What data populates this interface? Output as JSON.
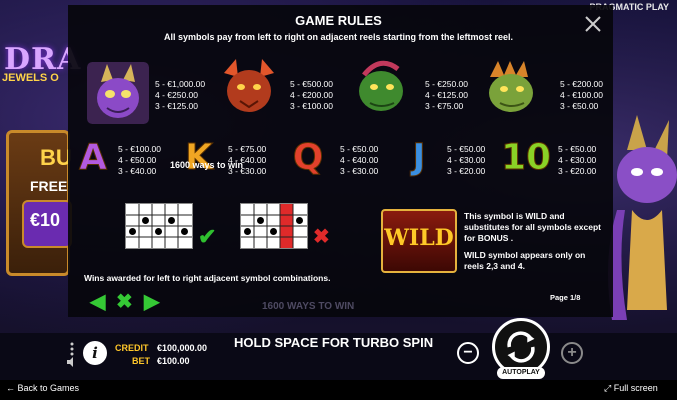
{
  "brand": "PRAGMATIC PLAY",
  "game": {
    "logo_title": "DRA",
    "logo_sub": "JEWELS O",
    "buy_title": "BU",
    "buy_free": "FREE",
    "buy_price": "€10"
  },
  "rules": {
    "title": "GAME RULES",
    "subtitle": "All symbols pay from left to right on adjacent reels starting from the leftmost reel.",
    "high_symbols": [
      {
        "icon": "purple-dragon-icon",
        "pays": "5 - €1,000.00\n4 - €250.00\n3 - €125.00",
        "color": "#7a3bb8"
      },
      {
        "icon": "red-dragon-icon",
        "pays": "5 - €500.00\n4 - €200.00\n3 - €100.00",
        "color": "#a0321c"
      },
      {
        "icon": "green-dragon-icon",
        "pays": "5 - €250.00\n4 - €125.00\n3 - €75.00",
        "color": "#2e7a2a"
      },
      {
        "icon": "orange-dragon-icon",
        "pays": "5 - €200.00\n4 - €100.00\n3 - €50.00",
        "color": "#b0781e"
      }
    ],
    "low_symbols": [
      {
        "letter": "A",
        "pays": "5 - €100.00\n4 - €50.00\n3 - €40.00",
        "color": "#b35adf"
      },
      {
        "letter": "K",
        "pays": "5 - €75.00\n4 - €40.00\n3 - €30.00",
        "color": "#f0a623"
      },
      {
        "letter": "Q",
        "pays": "5 - €50.00\n4 - €40.00\n3 - €30.00",
        "color": "#e2412c"
      },
      {
        "letter": "J",
        "pays": "5 - €50.00\n4 - €30.00\n3 - €20.00",
        "color": "#3b8fe0"
      },
      {
        "letter": "10",
        "pays": "5 - €50.00\n4 - €30.00\n3 - €20.00",
        "color": "#8ad226"
      }
    ],
    "ways_label": "1600 ways to win",
    "wild_label": "WILD",
    "wild_desc_1": "This symbol is WILD and substitutes for all symbols except for BONUS .",
    "wild_desc_2": "WILD symbol appears only on reels 2,3 and 4.",
    "wins_note": "Wins awarded for left to right adjacent symbol combinations.",
    "page": "Page 1/8",
    "footer_ways": "1600 WAYS TO WIN"
  },
  "bottom": {
    "credit_label": "CREDIT",
    "credit_value": "€100,000.00",
    "bet_label": "BET",
    "bet_value": "€100.00",
    "turbo": "HOLD SPACE FOR TURBO SPIN",
    "autoplay": "AUTOPLAY"
  },
  "status": {
    "back": "Back to Games",
    "fullscreen": "Full screen"
  }
}
